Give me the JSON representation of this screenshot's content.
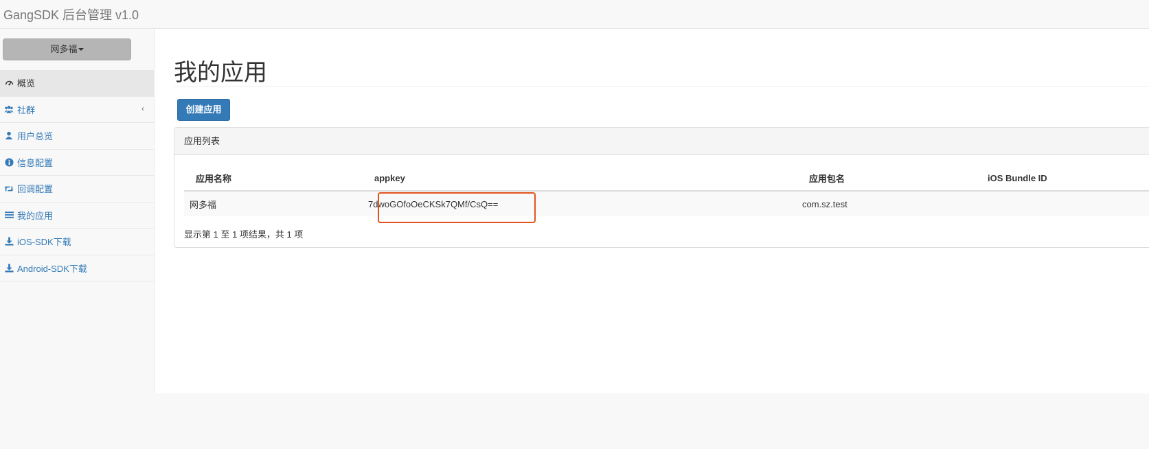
{
  "navbar": {
    "brand": "GangSDK 后台管理 v1.0"
  },
  "sidebar": {
    "user_button": "网多福",
    "items": [
      {
        "label": "概览",
        "icon": "dashboard-icon"
      },
      {
        "label": "社群",
        "icon": "users-icon"
      },
      {
        "label": "用户总览",
        "icon": "user-icon"
      },
      {
        "label": "信息配置",
        "icon": "info-icon"
      },
      {
        "label": "回调配置",
        "icon": "retweet-icon"
      },
      {
        "label": "我的应用",
        "icon": "list-icon"
      },
      {
        "label": "iOS-SDK下载",
        "icon": "download-icon"
      },
      {
        "label": "Android-SDK下载",
        "icon": "download-icon"
      }
    ],
    "arrow": "‹"
  },
  "main": {
    "title": "我的应用",
    "create_button": "创建应用",
    "panel": {
      "heading": "应用列表",
      "columns": [
        "应用名称",
        "appkey",
        "应用包名",
        "iOS Bundle ID"
      ],
      "rows": [
        [
          "网多福",
          "7dwoGOfoOeCKSk7QMf/CsQ==",
          "com.sz.test",
          ""
        ]
      ],
      "info": "显示第 1 至 1 项结果，共 1 项"
    }
  },
  "colors": {
    "accent": "#337ab7",
    "highlight": "#e2531c"
  }
}
